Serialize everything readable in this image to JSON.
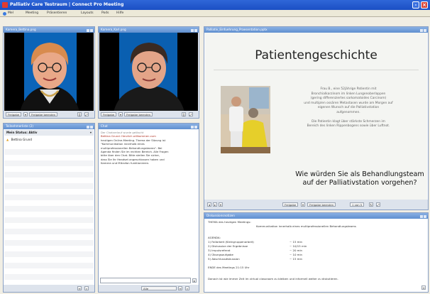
{
  "window": {
    "title": "Palliativ Care Testraum | Connect Pro Meeting"
  },
  "menu": {
    "items": [
      "Mel",
      "Meeting",
      "Präsentieren",
      "Layouts",
      "Pods",
      "Hilfe"
    ]
  },
  "video_pods": [
    {
      "title": "Kamera_Bettina.png",
      "share_label": "Freigabe",
      "stop_label": "Freigabe beenden"
    },
    {
      "title": "Kamera_Karl.png",
      "share_label": "Freigabe",
      "stop_label": "Freigabe beenden"
    }
  ],
  "attendees": {
    "title": "Teilnehmerliste (2)",
    "header": "Mein Status: Aktiv",
    "users": [
      {
        "name": "Bettina Grund",
        "role_icon": "presenter-icon"
      }
    ]
  },
  "chat": {
    "title": "Chat",
    "lines": [
      "Der Chatverlauf wurde gelöscht",
      "Bettina Grund: Herzlich willkommen zum",
      "heutigen Online-Meeting. Thema der Sitzung ist",
      "\"Kommunikation innerhalb eines",
      "multiprofessionellen Behandlungsteams\". Bei",
      "Agenda finden Sie im rechten Bereich. Alle Fragen",
      "bitte über den Chat. Bitte stellen Sie sicher,",
      "dass Sie Ihr Headset angeschlossen haben und",
      "Kamera und Mikrofon funktionieren."
    ],
    "target_label": "Alle"
  },
  "presentation": {
    "title": "Palliativ_Einfuehrung_Praesentation.pptx",
    "slide_title": "Patientengeschichte",
    "slide_body": [
      "Frau B., eine 52jährige Patientin mit",
      "Bronchialkarzinom im linken Lungenoberlappen",
      "(gering differenziertes sarkomatoides Carcinom)",
      "und multiplen ossären Metastasen wurde am Morgen auf",
      "eigenen Wunsch auf die Palliativstation",
      "aufgenommen.",
      "",
      "Die Patientin klagt über stärkste Schmerzen im",
      "Bereich des linken Rippenbogens sowie über Luftnot."
    ],
    "slide_question": [
      "Wie würden Sie als Behandlungsteam",
      "auf der Palliativstation vorgehen?"
    ],
    "share_label": "Freigabe",
    "stop_label": "Freigabe beenden",
    "page_label": "1 von 5"
  },
  "notes": {
    "title": "Diskussionsnotizen",
    "topic_label": "THEMA des heutigen Meetings:",
    "topic": "Kommunikation innerhalb eines multiprofessionellen Behandlungsteams",
    "agenda_label": "AGENDA:",
    "agenda": [
      {
        "item": "1) Fallarbeit (Kleingruppenarbeit)",
        "time": "~ 15 min"
      },
      {
        "item": "2) Diskussion der Ergebnisse",
        "time": "~ 10/15 min"
      },
      {
        "item": "3) Impulsreferat",
        "time": "~ 20 min"
      },
      {
        "item": "4) Übungsaufgabe",
        "time": "~ 10 min"
      },
      {
        "item": "5) Abschlussdiskussion",
        "time": "~ 15 min"
      }
    ],
    "end_line": "ENDE des Meetings 21:15 Uhr",
    "footer": "Danach ist wie immer Zeit im virtual classroom zu bleiben und informell weiter zu diskutieren."
  },
  "colors": {
    "title_bar": "#1b4fc4",
    "pod_header": "#6f9ad6",
    "accent_red": "#d9473b"
  }
}
